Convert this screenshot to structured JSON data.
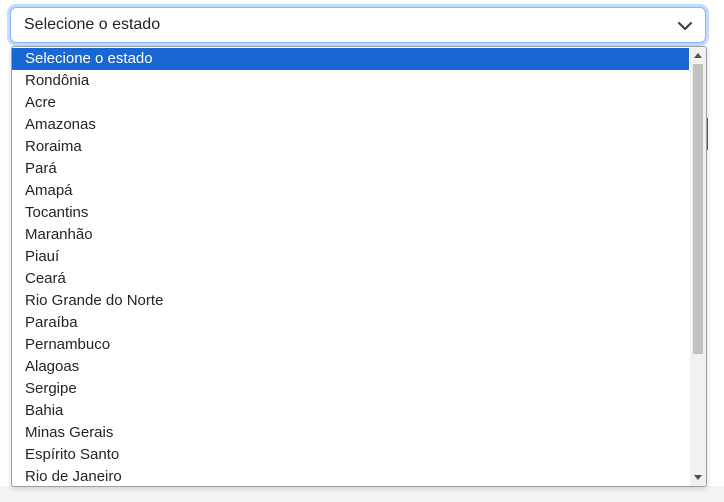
{
  "select": {
    "value": "Selecione o estado",
    "icon": "chevron-down-icon",
    "focus_color": "#86b7fe"
  },
  "dropdown": {
    "selected_index": 0,
    "selected_color": "#1967d2",
    "options": [
      "Selecione o estado",
      "Rondônia",
      "Acre",
      "Amazonas",
      "Roraima",
      "Pará",
      "Amapá",
      "Tocantins",
      "Maranhão",
      "Piauí",
      "Ceará",
      "Rio Grande do Norte",
      "Paraíba",
      "Pernambuco",
      "Alagoas",
      "Sergipe",
      "Bahia",
      "Minas Gerais",
      "Espírito Santo",
      "Rio de Janeiro"
    ]
  }
}
